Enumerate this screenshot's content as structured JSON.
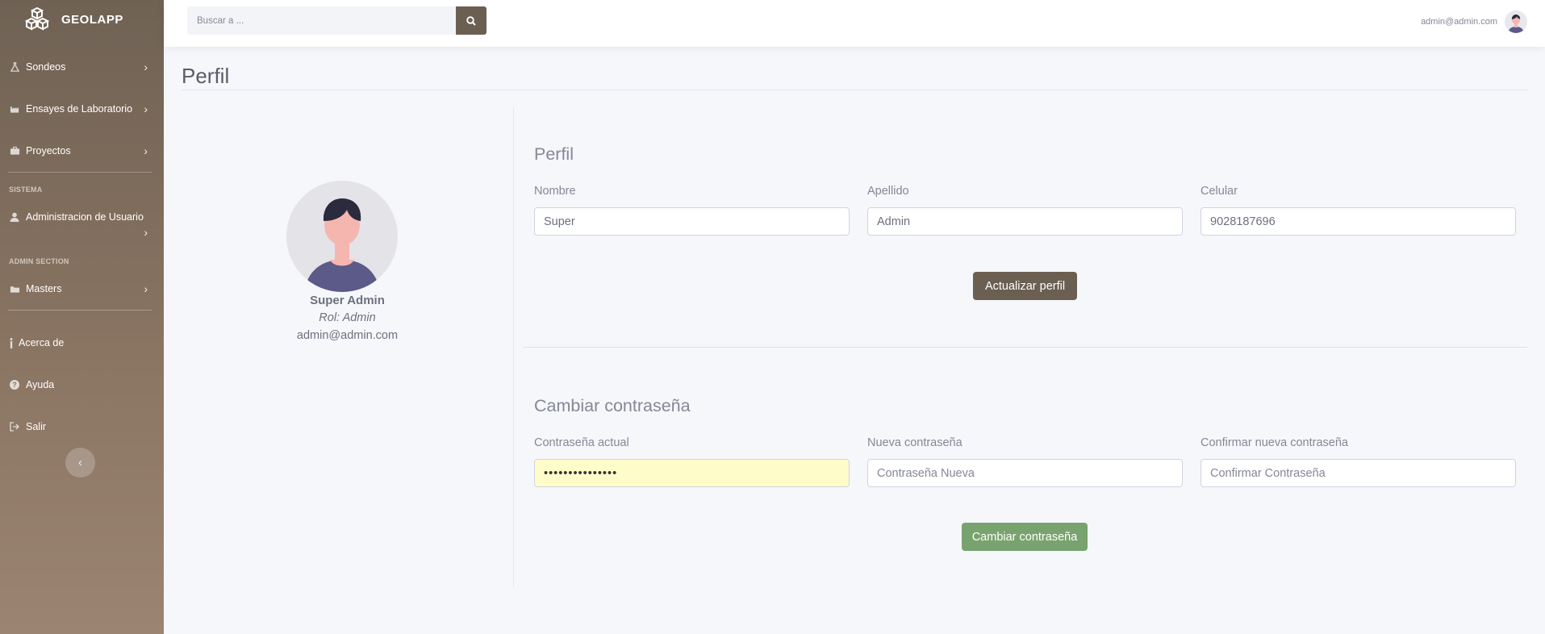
{
  "sidebar": {
    "brand": "GEOLAPP",
    "items": [
      {
        "label": "Sondeos",
        "icon": "flask-icon"
      },
      {
        "label": "Ensayes de Laboratorio",
        "icon": "industry-icon"
      },
      {
        "label": "Proyectos",
        "icon": "briefcase-icon"
      },
      {
        "label": "Administracion de Usuario",
        "icon": "user-icon"
      },
      {
        "label": "Masters",
        "icon": "folder-icon"
      },
      {
        "label": "Acerca de",
        "icon": "info-icon"
      },
      {
        "label": "Ayuda",
        "icon": "question-circle-icon"
      },
      {
        "label": "Salir",
        "icon": "sign-out-icon"
      }
    ],
    "sections": {
      "sistema": "SISTEMA",
      "admin": "ADMIN SECTION"
    }
  },
  "topbar": {
    "search_placeholder": "Buscar a ...",
    "user_email": "admin@admin.com"
  },
  "page": {
    "title": "Perfil"
  },
  "profile": {
    "name": "Super Admin",
    "role": "Rol: Admin",
    "email": "admin@admin.com"
  },
  "profile_form": {
    "title": "Perfil",
    "nombre_label": "Nombre",
    "nombre_value": "Super",
    "apellido_label": "Apellido",
    "apellido_value": "Admin",
    "celular_label": "Celular",
    "celular_value": "9028187696",
    "submit_label": "Actualizar perfil"
  },
  "password_form": {
    "title": "Cambiar contraseña",
    "current_label": "Contraseña actual",
    "current_value": "•••••••••••••••",
    "new_label": "Nueva contraseña",
    "new_placeholder": "Contraseña Nueva",
    "confirm_label": "Confirmar nueva contraseña",
    "confirm_placeholder": "Confirmar Contraseña",
    "submit_label": "Cambiar contraseña"
  },
  "colors": {
    "brand": "#6b5f52",
    "success": "#79a36e",
    "autofill": "#fefcc9"
  }
}
